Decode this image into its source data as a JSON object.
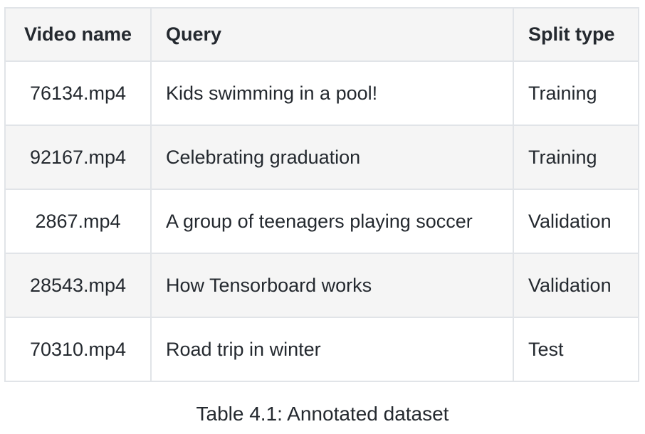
{
  "table": {
    "headers": [
      "Video name",
      "Query",
      "Split type"
    ],
    "rows": [
      [
        "76134.mp4",
        "Kids swimming in a pool!",
        "Training"
      ],
      [
        "92167.mp4",
        "Celebrating graduation",
        "Training"
      ],
      [
        "2867.mp4",
        "A group of teenagers playing soccer",
        "Validation"
      ],
      [
        "28543.mp4",
        "How Tensorboard works",
        "Validation"
      ],
      [
        "70310.mp4",
        "Road trip in winter",
        "Test"
      ]
    ]
  },
  "caption": "Table 4.1: Annotated dataset"
}
